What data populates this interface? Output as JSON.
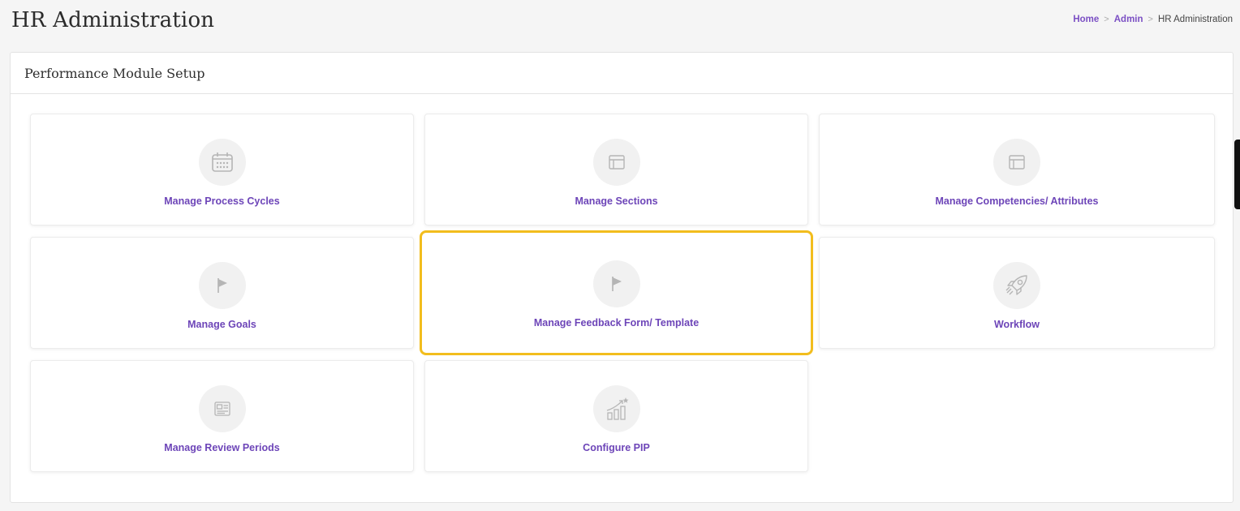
{
  "header": {
    "title": "HR Administration"
  },
  "breadcrumb": {
    "items": [
      "Home",
      "Admin",
      "HR Administration"
    ],
    "separator": ">"
  },
  "panel": {
    "title": "Performance Module Setup"
  },
  "cards": [
    {
      "label": "Manage Process Cycles",
      "icon": "calendar-icon"
    },
    {
      "label": "Manage Sections",
      "icon": "layout-icon"
    },
    {
      "label": "Manage Competencies/ Attributes",
      "icon": "layout-icon"
    },
    {
      "label": "Manage Goals",
      "icon": "flag-icon"
    },
    {
      "label": "Manage Feedback Form/ Template",
      "icon": "flag-icon",
      "highlighted": true
    },
    {
      "label": "Workflow",
      "icon": "rocket-icon"
    },
    {
      "label": "Manage Review Periods",
      "icon": "id-card-icon"
    },
    {
      "label": "Configure PIP",
      "icon": "growth-chart-icon"
    }
  ],
  "colors": {
    "accent": "#6d45b8",
    "breadcrumb_link": "#7b4fc4",
    "highlight_border": "#f2bd1d",
    "icon_gray": "#b5b5b5",
    "icon_bg": "#f1f1f1"
  }
}
